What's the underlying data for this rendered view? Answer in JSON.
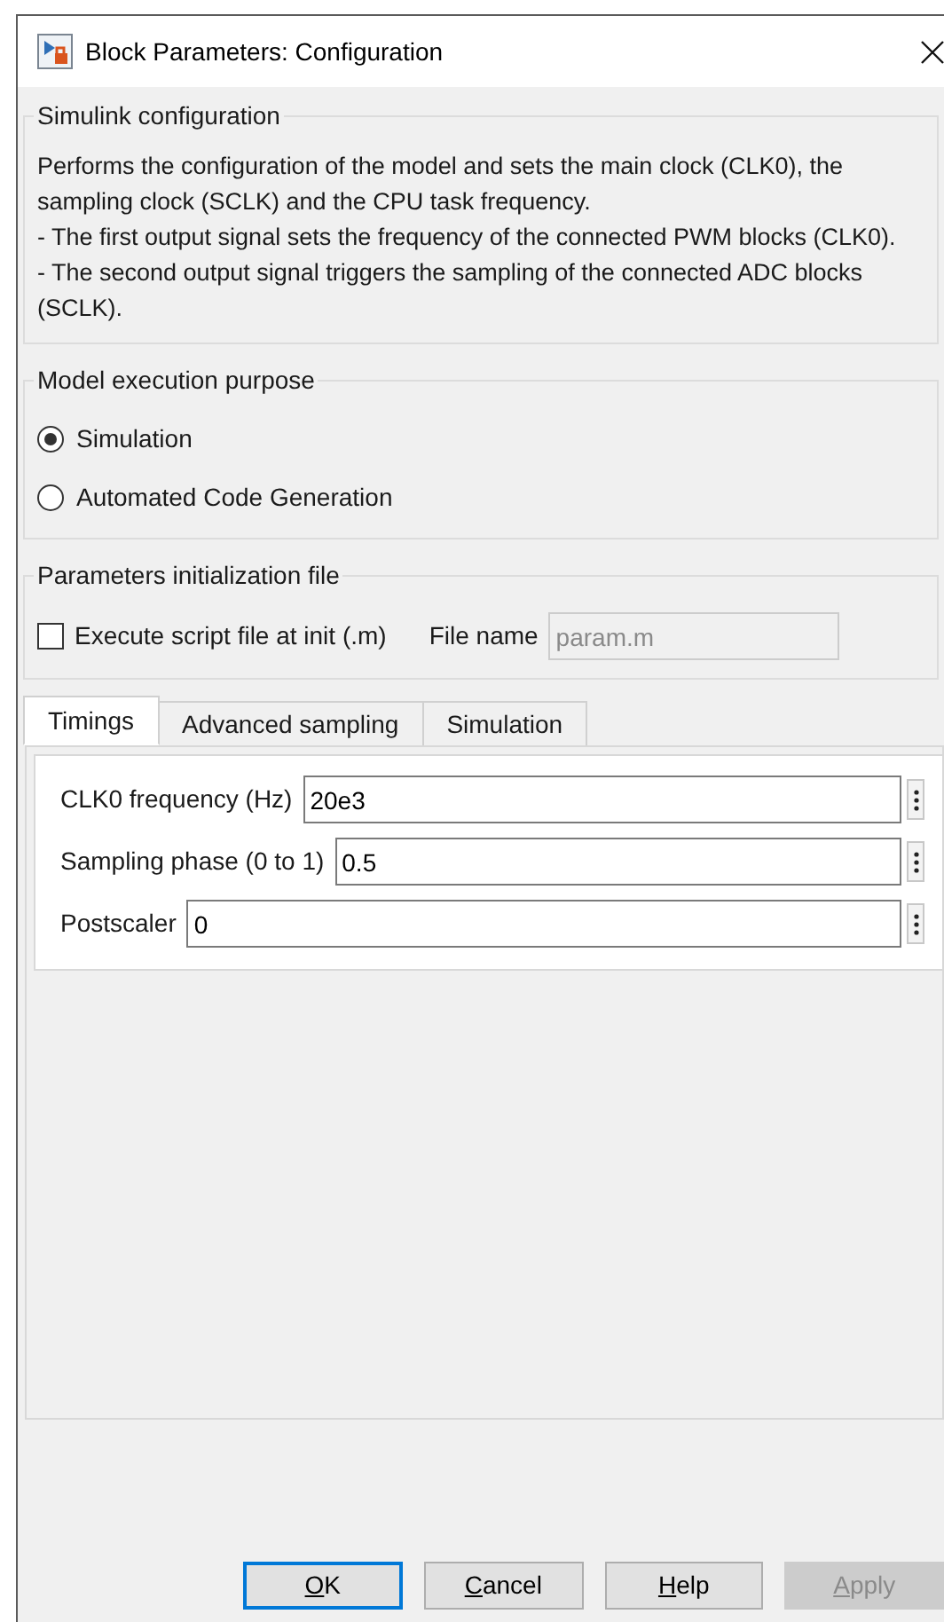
{
  "window": {
    "title": "Block Parameters: Configuration"
  },
  "description_group": {
    "legend": "Simulink configuration",
    "text": "Performs the configuration of the model and sets the main clock (CLK0), the sampling clock (SCLK) and the CPU task frequency.\n- The first output signal sets the frequency of the connected PWM blocks (CLK0).\n- The second output signal triggers the sampling of the connected ADC blocks (SCLK)."
  },
  "purpose_group": {
    "legend": "Model execution purpose",
    "options": [
      {
        "label": "Simulation",
        "selected": true
      },
      {
        "label": "Automated Code Generation",
        "selected": false
      }
    ]
  },
  "init_group": {
    "legend": "Parameters initialization file",
    "checkbox": {
      "label": "Execute script file at init (.m)",
      "checked": false
    },
    "file_label": "File name",
    "file_value": "param.m",
    "file_disabled": true
  },
  "tabs": [
    {
      "label": "Timings",
      "selected": true
    },
    {
      "label": "Advanced sampling",
      "selected": false
    },
    {
      "label": "Simulation",
      "selected": false
    }
  ],
  "parameters": [
    {
      "label": "CLK0 frequency (Hz)",
      "value": "20e3"
    },
    {
      "label": "Sampling phase (0 to 1)",
      "value": "0.5"
    },
    {
      "label": "Postscaler",
      "value": "0"
    }
  ],
  "buttons": [
    {
      "label": "OK",
      "default": true,
      "disabled": false
    },
    {
      "label": "Cancel",
      "default": false,
      "disabled": false
    },
    {
      "label": "Help",
      "default": false,
      "disabled": false
    },
    {
      "label": "Apply",
      "default": false,
      "disabled": true
    }
  ]
}
